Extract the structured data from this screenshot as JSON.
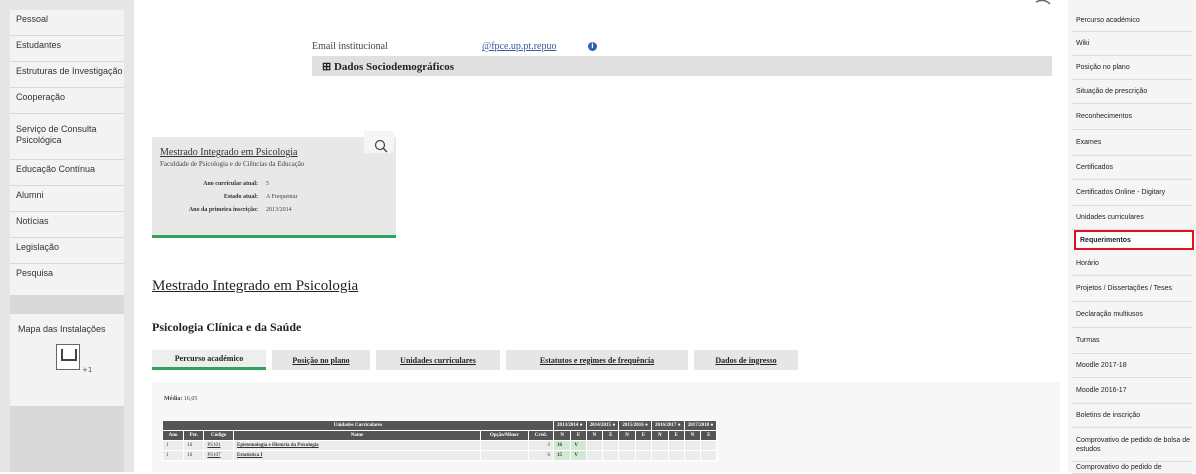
{
  "left_nav": {
    "items": [
      "Pessoal",
      "Estudantes",
      "Estruturas de Investigação",
      "Cooperação",
      "Serviço de Consulta Psicológica",
      "Educação Contínua",
      "Alumni",
      "Notícias",
      "Legislação",
      "Pesquisa"
    ],
    "map_label": "Mapa das Instalações",
    "map_level": "+1"
  },
  "right_nav": {
    "items": [
      "Percurso académico",
      "Wiki",
      "Posição no plano",
      "Situação de prescrição",
      "Reconhecimentos",
      "Exames",
      "Certificados",
      "Certificados Online - Digitary",
      "Unidades curriculares",
      "Requerimentos",
      "Horário",
      "Projetos / Dissertações / Teses",
      "Declaração multiusos",
      "Turmas",
      "Moodle 2017-18",
      "Moodle 2016-17",
      "Boletins de inscrição",
      "Comprovativo de pedido de bolsa de estudos",
      "Comprovativo do pedido de"
    ],
    "active_index": 9
  },
  "profile": {
    "email_label": "Email institucional",
    "email_value": "@fpce.up.pt.repuo",
    "socio_label": "Dados Sociodemográficos"
  },
  "card": {
    "title": "Mestrado Integrado em Psicologia",
    "subtitle": "Faculdade de Psicologia e de Ciências da Educação",
    "rows": [
      {
        "label": "Ano curricular atual:",
        "value": "5"
      },
      {
        "label": "Estado atual:",
        "value": "A Frequentar"
      },
      {
        "label": "Ano da primeira inscrição:",
        "value": "2013/2014"
      }
    ]
  },
  "main": {
    "heading": "Mestrado Integrado em Psicologia",
    "subheading": "Psicologia Clínica e da Saúde",
    "tabs": [
      "Percurso académico",
      "Posição no plano",
      "Unidades curriculares",
      "Estatutos e regimes de frequência",
      "Dados de ingresso"
    ],
    "active_tab": 0,
    "media_label": "Média:",
    "media_value": "16,05"
  },
  "table": {
    "group_header": "Unidades Curriculares",
    "years": [
      "2013/2014",
      "2014/2015",
      "2015/2016",
      "2016/2017",
      "2017/2018"
    ],
    "columns": [
      "Ano",
      "Per.",
      "Código",
      "Nome",
      "Opção/Minor",
      "Créd."
    ],
    "sub_cols": [
      "N",
      "E"
    ],
    "rows": [
      {
        "ano": "1",
        "per": "1S",
        "codigo": "PS101",
        "nome": "Epistemologia e História da Psicologia",
        "opcao": "",
        "cred": "3",
        "n": "16",
        "e": "V"
      },
      {
        "ano": "1",
        "per": "1S",
        "codigo": "PS107",
        "nome": "Estatística I",
        "opcao": "",
        "cred": "6",
        "n": "15",
        "e": "V"
      }
    ]
  }
}
